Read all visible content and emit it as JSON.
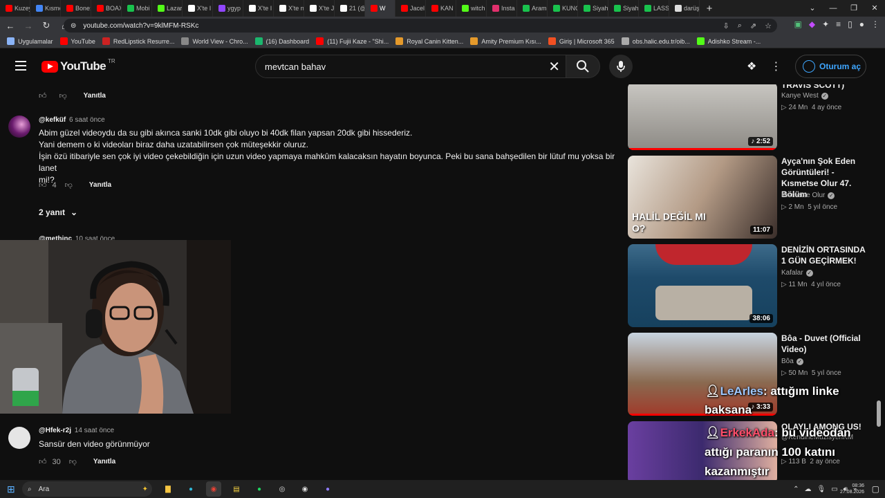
{
  "tabs": [
    {
      "title": "Kuzey",
      "color": "#ff0000"
    },
    {
      "title": "Kısme",
      "color": "#4285f4"
    },
    {
      "title": "Bone:",
      "color": "#ff0000"
    },
    {
      "title": "BOAX",
      "color": "#ff0000"
    },
    {
      "title": "Mobi",
      "color": "#19c24d"
    },
    {
      "title": "Lazar",
      "color": "#53fc18"
    },
    {
      "title": "X'te I",
      "color": "#ffffff"
    },
    {
      "title": "ygyp",
      "color": "#9146ff"
    },
    {
      "title": "X'te I",
      "color": "#ffffff"
    },
    {
      "title": "X'te n",
      "color": "#ffffff"
    },
    {
      "title": "X'te J",
      "color": "#ffffff"
    },
    {
      "title": "21 (@",
      "color": "#ffffff"
    },
    {
      "title": "W",
      "color": "#ff0000",
      "active": true
    },
    {
      "title": "Jacel",
      "color": "#ff0000"
    },
    {
      "title": "KAN",
      "color": "#ff0000"
    },
    {
      "title": "witch",
      "color": "#53fc18"
    },
    {
      "title": "Insta",
      "color": "#e1306c"
    },
    {
      "title": "Aram",
      "color": "#19c24d"
    },
    {
      "title": "KUNC",
      "color": "#19c24d"
    },
    {
      "title": "Siyah",
      "color": "#19c24d"
    },
    {
      "title": "Siyah",
      "color": "#19c24d"
    },
    {
      "title": "LASS",
      "color": "#19c24d"
    },
    {
      "title": "darüş",
      "color": "#dddddd"
    }
  ],
  "browser": {
    "url": "youtube.com/watch?v=9klMFM-RSKc",
    "new_tab": "+"
  },
  "bookmarks": [
    {
      "label": "Uygulamalar",
      "color": "#8ab4f8"
    },
    {
      "label": "YouTube",
      "color": "#ff0000"
    },
    {
      "label": "RedLipstick Resurre...",
      "color": "#cc2222"
    },
    {
      "label": "World View - Chro...",
      "color": "#888888"
    },
    {
      "label": "(16) Dashboard",
      "color": "#1bb76e"
    },
    {
      "label": "(11) Fujii Kaze - \"Shi...",
      "color": "#ff0000"
    },
    {
      "label": "Royal Canin Kitten...",
      "color": "#e59a2b"
    },
    {
      "label": "Amity Premium Kısı...",
      "color": "#e59a2b"
    },
    {
      "label": "Giriş | Microsoft 365",
      "color": "#f25022"
    },
    {
      "label": "obs.halic.edu.tr/oib...",
      "color": "#aaaaaa"
    },
    {
      "label": "Adishko Stream -...",
      "color": "#53fc18"
    }
  ],
  "youtube": {
    "logo": "YouTube",
    "region": "TR",
    "search_query": "mevtcan bahav",
    "signin": "Oturum aç"
  },
  "comments": {
    "top_reply": "Yanıtla",
    "c1": {
      "author": "@kefküf",
      "time": "6 saat önce",
      "lines": [
        "Abim güzel videoydu da su gibi akınca sanki 10dk gibi oluyo bi 40dk filan yapsan 20dk gibi hissederiz.",
        "Yani demem o ki videoları biraz daha uzatabilirsen çok müteşekkir oluruz.",
        "İşin özü itibariyle sen çok iyi video çekebildiğin için uzun video yapmaya mahkûm kalacaksın hayatın boyunca. Peki bu sana bahşedilen bir lütuf mu yoksa bir lanet",
        "mi!?"
      ],
      "likes": "4",
      "reply": "Yanıtla",
      "replies": "2 yanıt"
    },
    "c2": {
      "author": "@methinc",
      "time": "10 saat önce"
    },
    "c3": {
      "author": "@Hfek-r2j",
      "time": "14 saat önce",
      "text": "Sansür den video görünmüyor",
      "likes": "30",
      "reply": "Yanıtla"
    }
  },
  "related": [
    {
      "title": "TRAVIS SCOTT)",
      "channel": "Kanye West",
      "views": "24 Mn",
      "age": "4 ay önce",
      "duration": "2:52",
      "music": true
    },
    {
      "title": "Ayça'nın Şok Eden Görüntüleri! - Kısmetse Olur 47. Bölüm",
      "channel": "Kısmetse Olur",
      "views": "2 Mn",
      "age": "5 yıl önce",
      "duration": "11:07",
      "thumb_text": "HALİL DEĞİL MI O?"
    },
    {
      "title": "DENİZİN ORTASINDA 1 GÜN GEÇİRMEK!",
      "channel": "Kafalar",
      "views": "11 Mn",
      "age": "4 yıl önce",
      "duration": "38:06"
    },
    {
      "title": "Bôa - Duvet (Official Video)",
      "channel": "Bôa",
      "views": "50 Mn",
      "age": "5 yıl önce",
      "duration": "3:33",
      "music": true
    },
    {
      "title": "OLAYLI AMONG US!",
      "channel": "@KendineMüzisyenKM",
      "views": "113 B",
      "age": "2 ay önce"
    }
  ],
  "chat_overlay": [
    {
      "user": "LeArles",
      "message": ": attığım linke",
      "line2": "baksana"
    },
    {
      "user": "ErkekAda",
      "message": ": bu videodan",
      "line2": "attığı paranın 100 katını",
      "line3": "kazanmıştır"
    }
  ],
  "taskbar": {
    "search": "Ara",
    "time": "08:36",
    "date": "27.08.2026"
  }
}
